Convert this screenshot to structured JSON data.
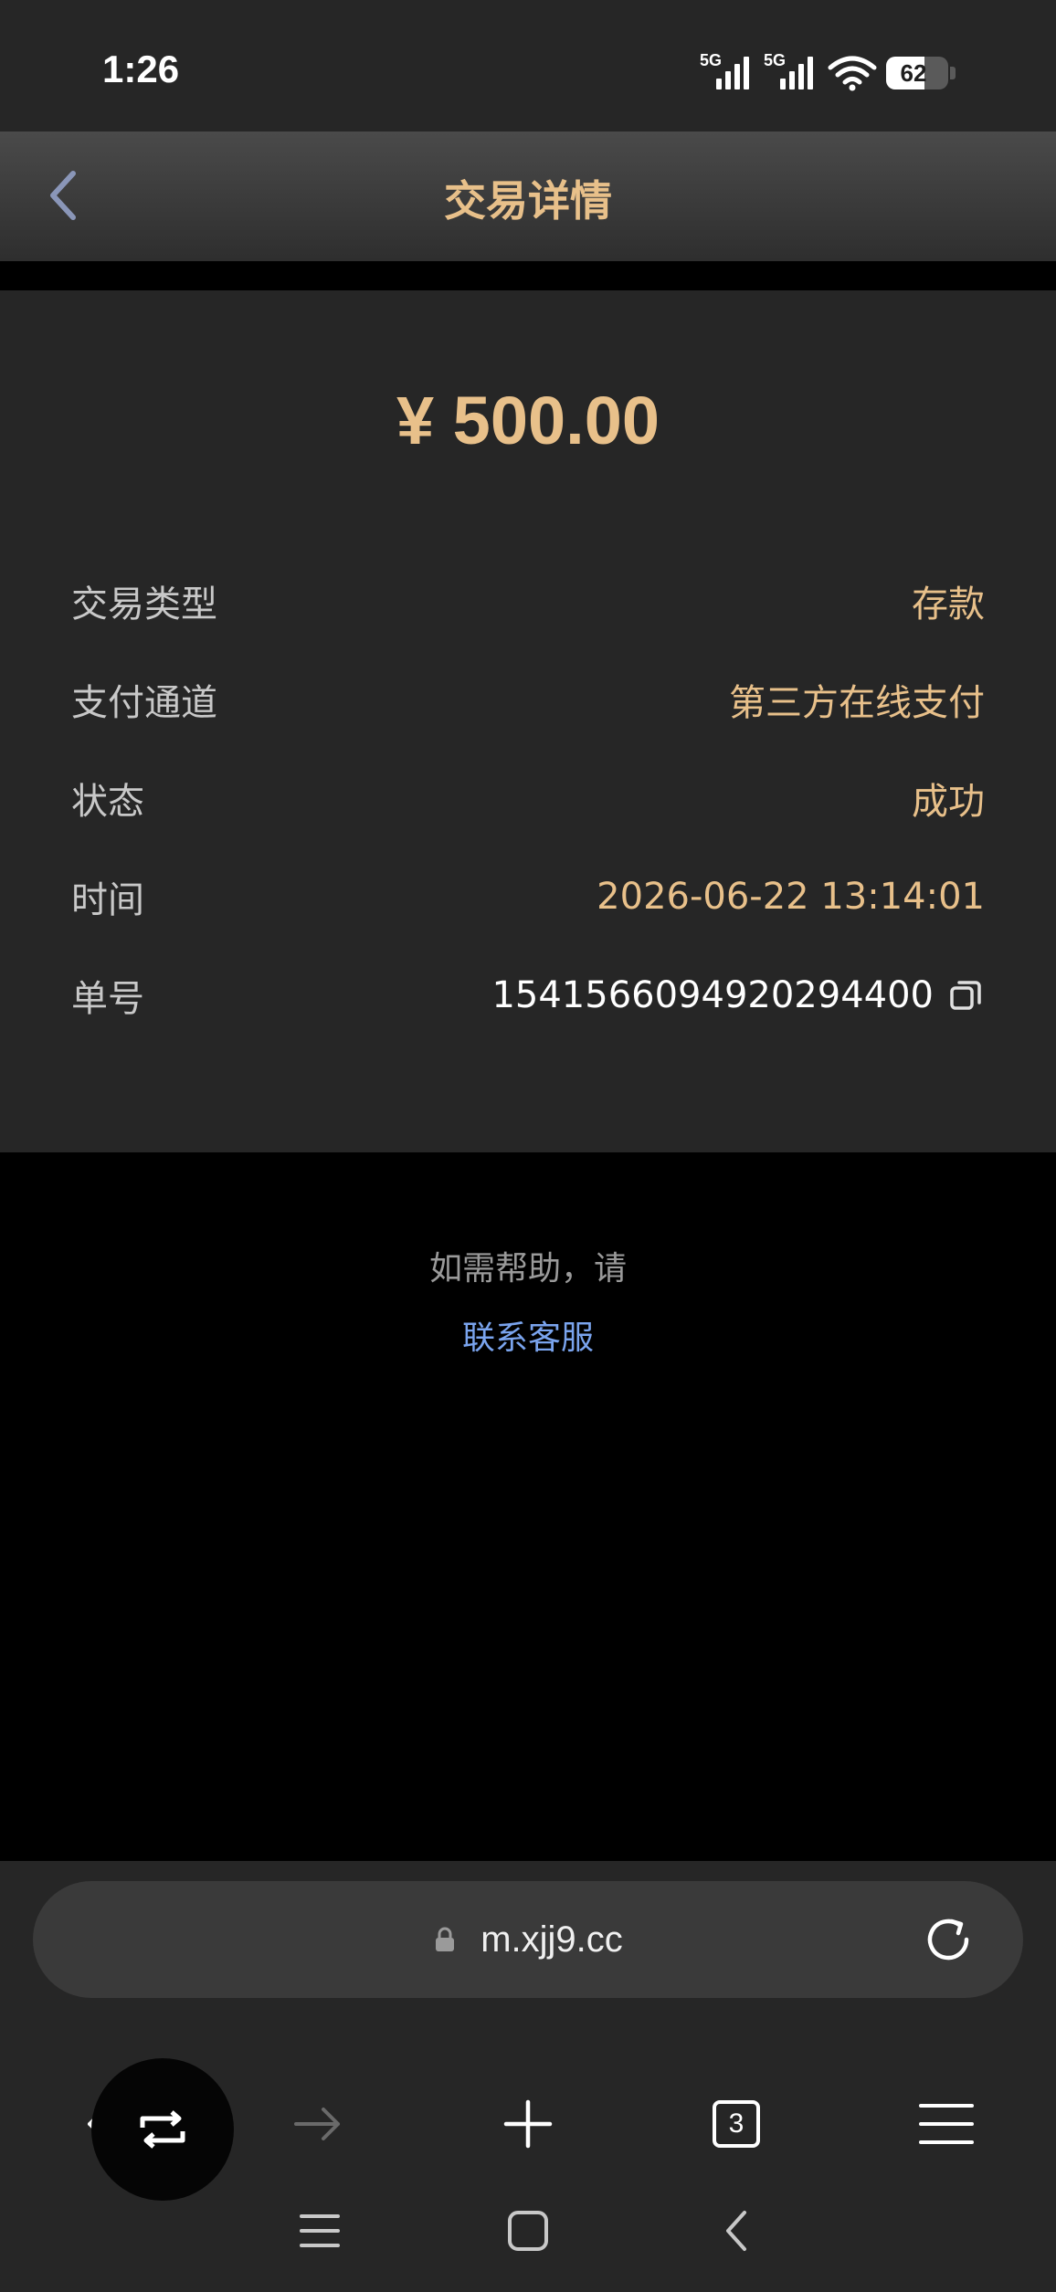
{
  "status_bar": {
    "time": "1:26",
    "signal_1_label": "5G",
    "signal_2_label": "5G",
    "wifi_icon": "wifi-icon",
    "battery_level": "62"
  },
  "header": {
    "title": "交易详情",
    "back_icon": "chevron-left-icon"
  },
  "transaction": {
    "amount": "¥ 500.00",
    "rows": [
      {
        "label": "交易类型",
        "value": "存款"
      },
      {
        "label": "支付通道",
        "value": "第三方在线支付"
      },
      {
        "label": "状态",
        "value": "成功"
      },
      {
        "label": "时间",
        "value": "2026-06-22 13:14:01"
      },
      {
        "label": "单号",
        "value": "1541566094920294400"
      }
    ],
    "copy_icon": "copy-icon"
  },
  "help": {
    "text": "如需帮助，请",
    "link": "联系客服"
  },
  "browser": {
    "url": "m.xjj9.cc",
    "tab_count": "3"
  },
  "colors": {
    "accent_gold": "#e8c08a",
    "link_blue": "#7aa4ee",
    "card_bg": "#262626",
    "page_bg": "#000000"
  }
}
